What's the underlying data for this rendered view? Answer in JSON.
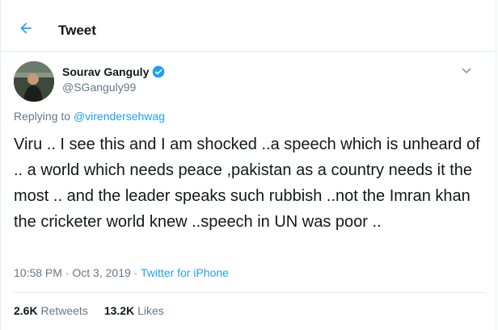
{
  "header": {
    "title": "Tweet"
  },
  "author": {
    "name": "Sourav Ganguly",
    "handle": "@SGanguly99"
  },
  "reply": {
    "prefix": "Replying to",
    "to": "@virendersehwag"
  },
  "tweet": {
    "text": "Viru .. I see this and I am shocked ..a speech which is unheard of .. a world which needs peace ,pakistan as a country needs it the most .. and the leader speaks such rubbish ..not the Imran khan the cricketer world knew ..speech in UN was poor .."
  },
  "meta": {
    "time": "10:58 PM",
    "sep1": " · ",
    "date": "Oct 3, 2019",
    "sep2": " · ",
    "source": "Twitter for iPhone"
  },
  "stats": {
    "retweets_count": "2.6K",
    "retweets_label": " Retweets",
    "likes_count": "13.2K",
    "likes_label": " Likes"
  },
  "colors": {
    "accent": "#1da1f2",
    "muted": "#657786",
    "border": "#e6ecf0",
    "verified": "#1da1f2"
  },
  "icons": {
    "back": "back-arrow-icon",
    "verified": "verified-badge-icon",
    "menu": "chevron-down-icon"
  }
}
